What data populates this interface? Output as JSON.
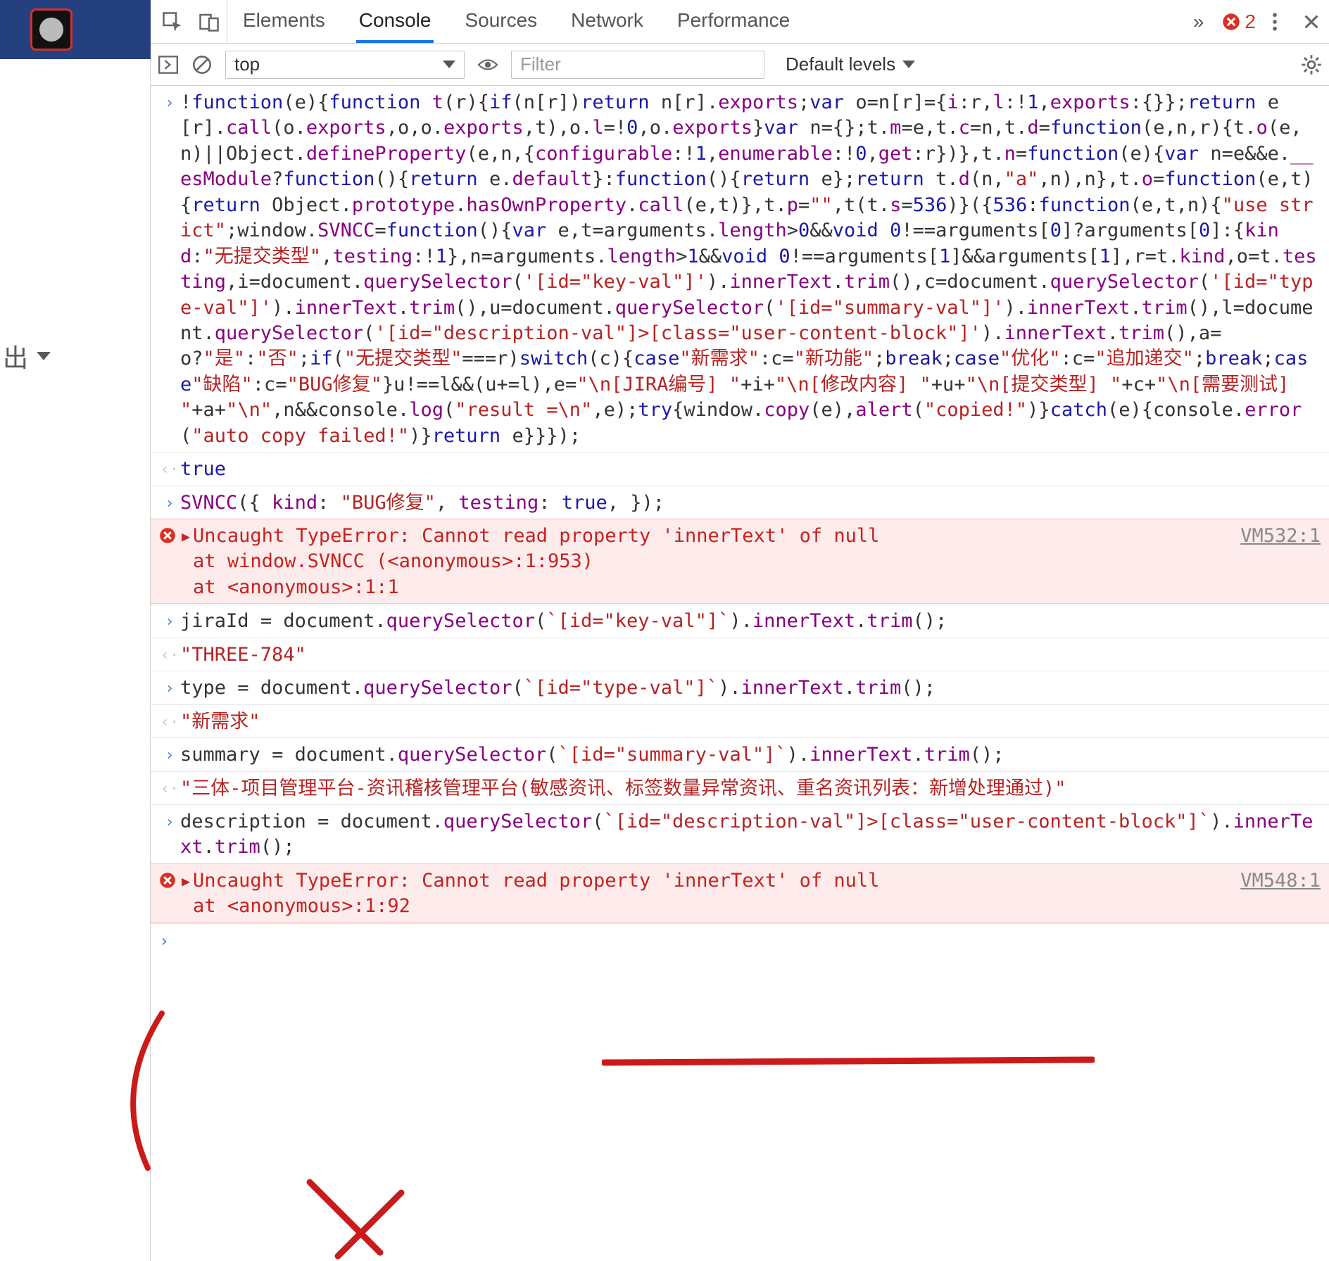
{
  "sidebar": {
    "out_label": "出"
  },
  "tabs": {
    "elements": "Elements",
    "console": "Console",
    "sources": "Sources",
    "network": "Network",
    "performance": "Performance",
    "more": "»",
    "error_count": "2"
  },
  "toolbar": {
    "context": "top",
    "filter_placeholder": "Filter",
    "levels": "Default levels"
  },
  "rows": {
    "r1_code": "!function(e){function t(r){if(n[r])return n[r].exports;var o=n[r]={i:r,l:!1,exports:{}};return e[r].call(o.exports,o,o.exports,t),o.l=!0,o.exports}var n={};t.m=e,t.c=n,t.d=function(e,n,r){t.o(e,n)||Object.defineProperty(e,n,{configurable:!1,enumerable:!0,get:r})},t.n=function(e){var n=e&&e.__esModule?function(){return e.default}:function(){return e};return t.d(n,\"a\",n),n},t.o=function(e,t){return Object.prototype.hasOwnProperty.call(e,t)},t.p=\"\",t(t.s=536)}({536:function(e,t,n){\"use strict\";window.SVNCC=function(){var e,t=arguments.length>0&&void 0!==arguments[0]?arguments[0]:{kind:\"无提交类型\",testing:!1},n=arguments.length>1&&void 0!==arguments[1]&&arguments[1],r=t.kind,o=t.testing,i=document.querySelector('[id=\"key-val\"]').innerText.trim(),c=document.querySelector('[id=\"type-val\"]').innerText.trim(),u=document.querySelector('[id=\"summary-val\"]').innerText.trim(),l=document.querySelector('[id=\"description-val\"]>[class=\"user-content-block\"]').innerText.trim(),a=o?\"是\":\"否\";if(\"无提交类型\"===r)switch(c){case\"新需求\":c=\"新功能\";break;case\"优化\":c=\"追加递交\";break;case\"缺陷\":c=\"BUG修复\"}u!==l&&(u+=l),e=\"\\n[JIRA编号] \"+i+\"\\n[修改内容] \"+u+\"\\n[提交类型] \"+c+\"\\n[需要测试] \"+a+\"\\n\",n&&console.log(\"result =\\n\",e);try{window.copy(e),alert(\"copied!\")}catch(e){console.error(\"auto copy failed!\")}return e}}});",
    "r2_val": "true",
    "r3_code": "SVNCC({ kind: \"BUG修复\", testing: true, });",
    "r4_err_l1": "Uncaught TypeError: Cannot read property 'innerText' of null",
    "r4_err_l2": "    at window.SVNCC (<anonymous>:1:953)",
    "r4_err_l3": "    at <anonymous>:1:1",
    "r4_src": "VM532:1",
    "r5_code": "jiraId = document.querySelector(`[id=\"key-val\"]`).innerText.trim();",
    "r6_val": "\"THREE-784\"",
    "r7_code": "type = document.querySelector(`[id=\"type-val\"]`).innerText.trim();",
    "r8_val": "\"新需求\"",
    "r9_code": "summary = document.querySelector(`[id=\"summary-val\"]`).innerText.trim();",
    "r10_val": "\"三体-项目管理平台-资讯稽核管理平台(敏感资讯、标签数量异常资讯、重名资讯列表：新增处理通过)\"",
    "r11_code": "description = document.querySelector(`[id=\"description-val\"]>[class=\"user-content-block\"]`).innerText.trim();",
    "r12_err_l1": "Uncaught TypeError: Cannot read property 'innerText' of null",
    "r12_err_l2": "    at <anonymous>:1:92",
    "r12_src": "VM548:1"
  },
  "colors": {
    "blue": "#1a1aa6",
    "purple": "#860080",
    "string": "#b52323",
    "error": "#c5221f",
    "error_bg": "#fdeceb",
    "tab_active": "#1a73e8"
  }
}
